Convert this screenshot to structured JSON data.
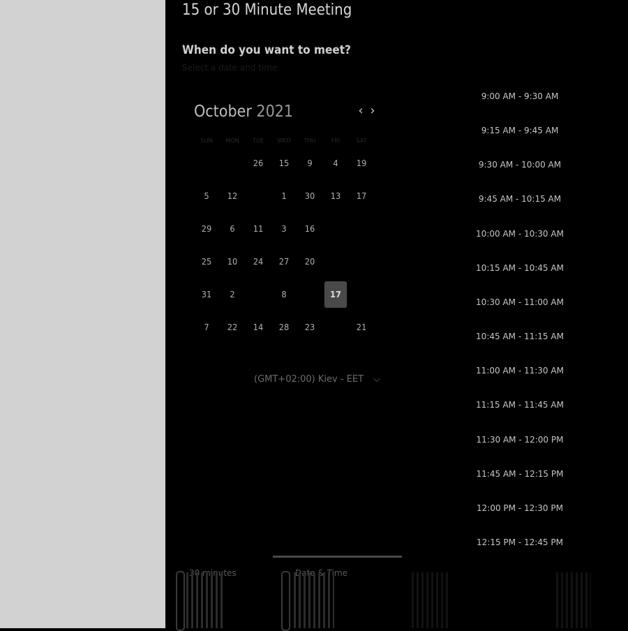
{
  "sidebar": {},
  "main": {
    "title": "15 or 30 Minute Meeting",
    "question": "When do you want to meet?",
    "hint": "Select a date and time"
  },
  "calendar": {
    "month": "October",
    "year": "2021",
    "prev_icon": "chevron-left-icon",
    "next_icon": "chevron-right-icon",
    "weekdays": [
      "SUN",
      "MON",
      "TUE",
      "WED",
      "THU",
      "FRI",
      "SAT"
    ],
    "weeks": [
      [
        "",
        "",
        "26",
        "15",
        "9",
        "4",
        "19"
      ],
      [
        "5",
        "12",
        "",
        "1",
        "30",
        "13",
        "17"
      ],
      [
        "29",
        "6",
        "11",
        "3",
        "16",
        "",
        ""
      ],
      [
        "25",
        "10",
        "24",
        "27",
        "20",
        "",
        ""
      ],
      [
        "31",
        "2",
        "",
        "8",
        "",
        "17",
        ""
      ],
      [
        "7",
        "22",
        "14",
        "28",
        "23",
        "",
        "21"
      ]
    ],
    "selected": "17"
  },
  "timezone": {
    "label": "(GMT+02:00) Kiev - EET",
    "icon": "chevron-down-icon"
  },
  "time_slots": [
    "9:00 AM - 9:30 AM",
    "9:15 AM - 9:45 AM",
    "9:30 AM - 10:00 AM",
    "9:45 AM - 10:15 AM",
    "10:00 AM - 10:30 AM",
    "10:15 AM - 10:45 AM",
    "10:30 AM - 11:00 AM",
    "10:45 AM - 11:15 AM",
    "11:00 AM - 11:30 AM",
    "11:15 AM - 11:45 AM",
    "11:30 AM - 12:00 PM",
    "11:45 AM - 12:15 PM",
    "12:00 PM - 12:30 PM",
    "12:15 PM - 12:45 PM"
  ],
  "footer": {
    "duration_label": "30 minutes",
    "datetime_label": "Date & Time"
  },
  "colors": {
    "sidebar_bg": "#d2d2d2",
    "main_bg": "#000000",
    "selected_day": "#494949"
  }
}
